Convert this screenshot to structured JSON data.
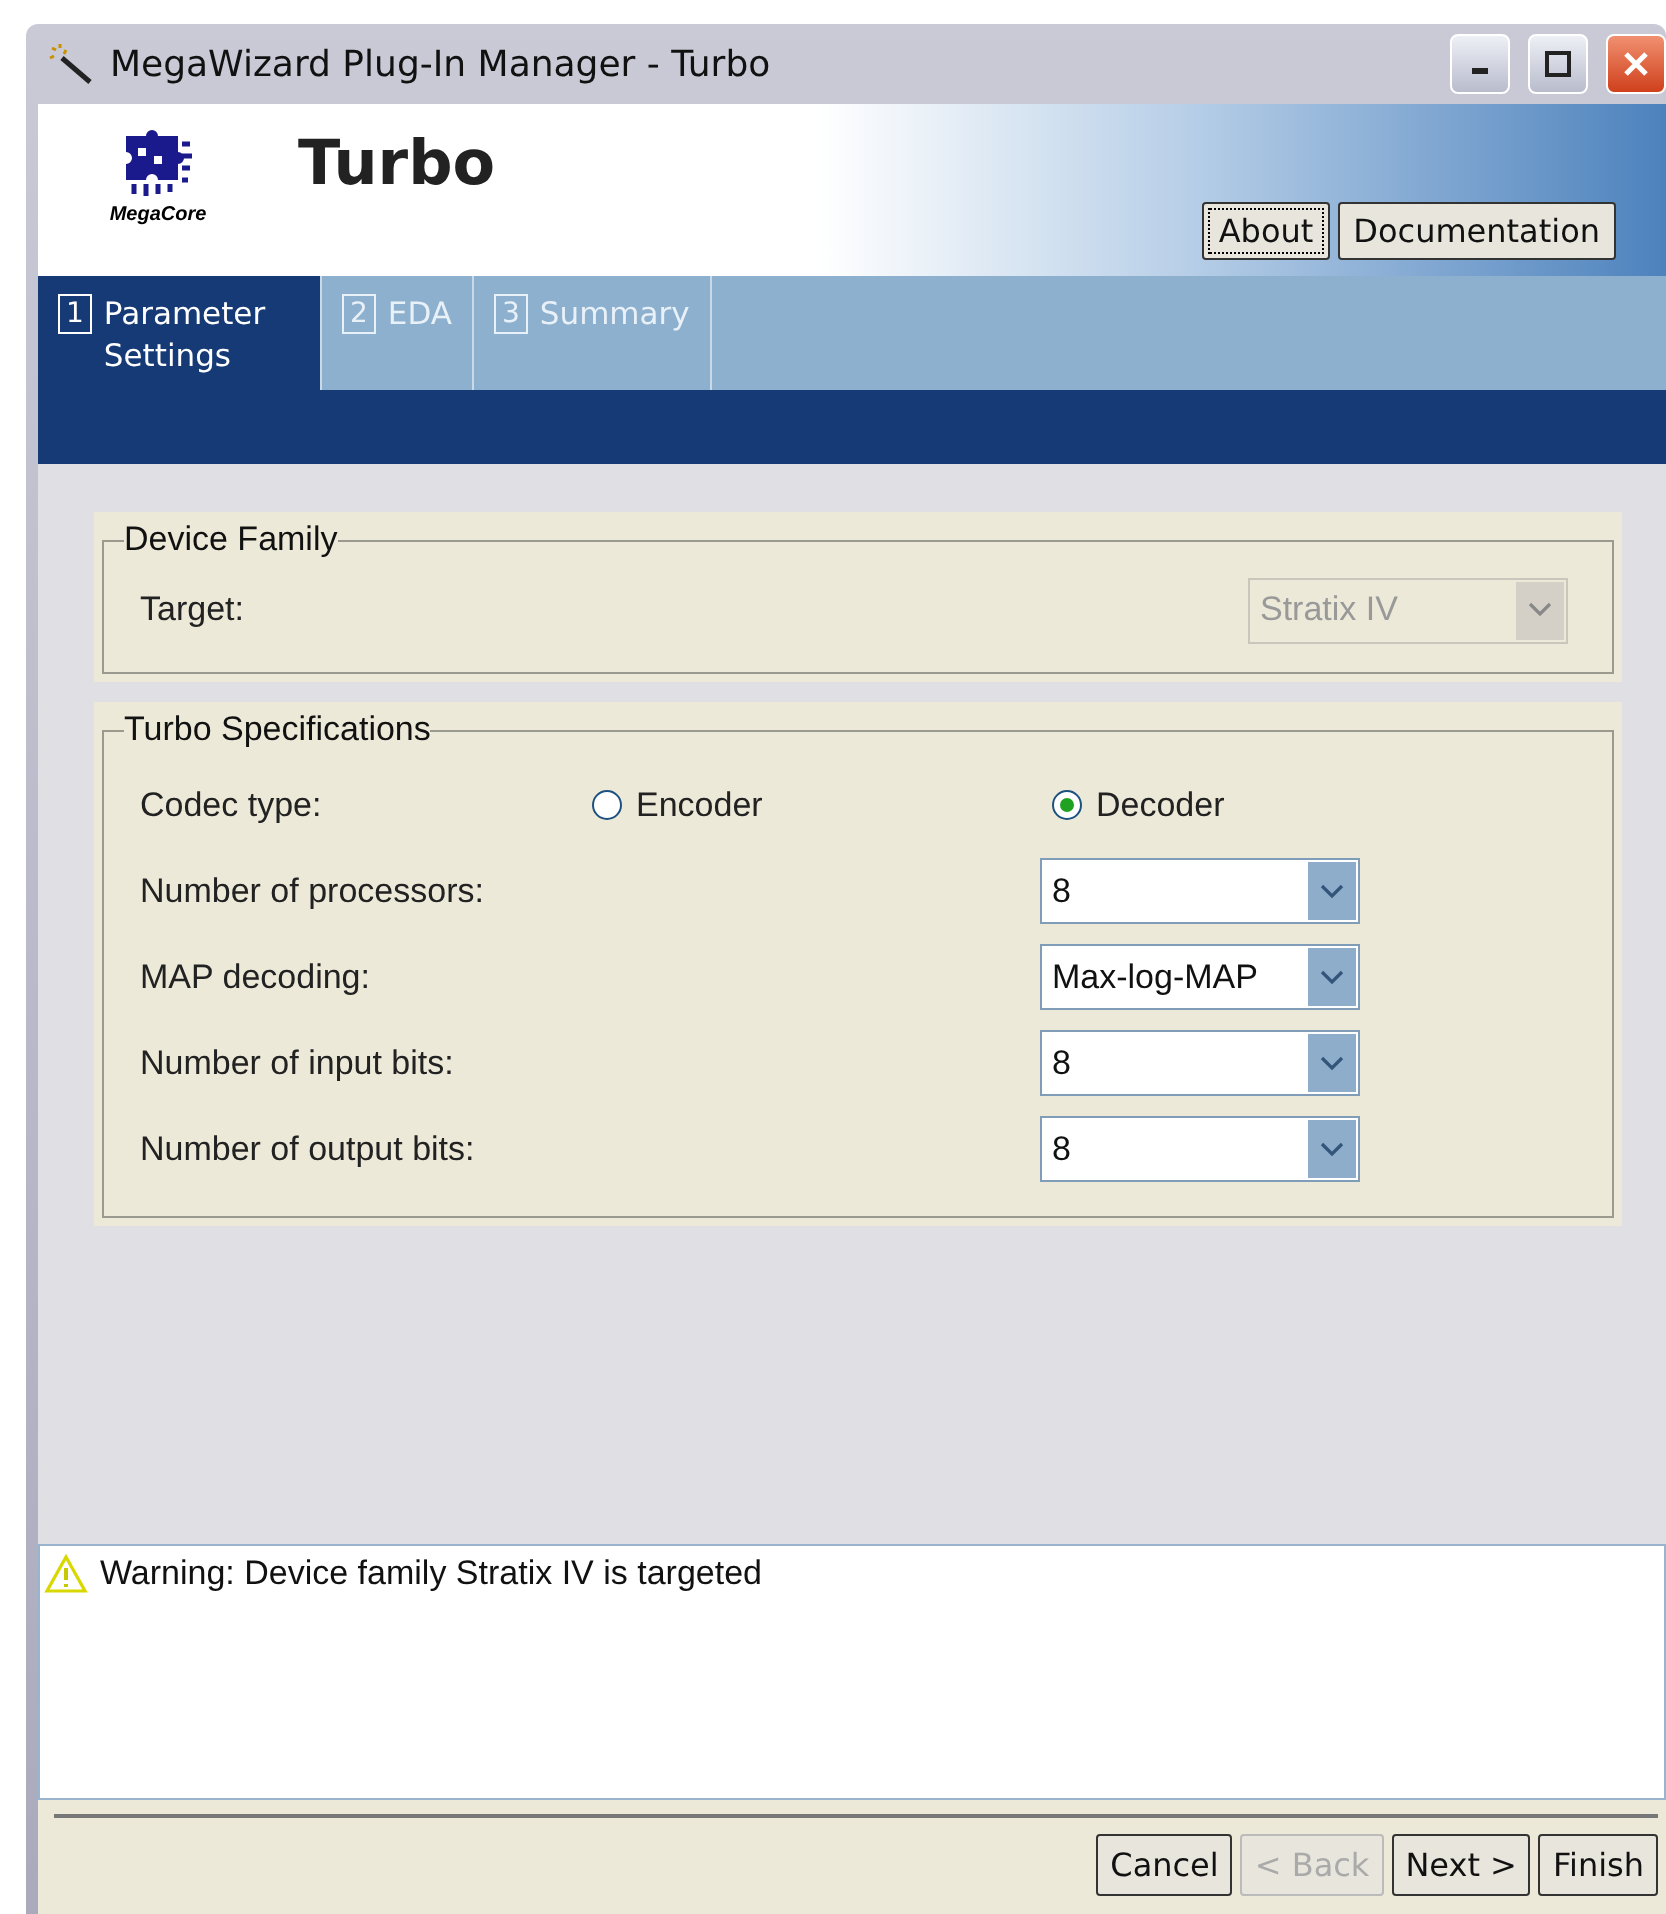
{
  "window": {
    "title": "MegaWizard Plug-In Manager - Turbo"
  },
  "header": {
    "title": "Turbo",
    "logo_caption": "MegaCore",
    "buttons": [
      {
        "label": "About",
        "focused": true
      },
      {
        "label": "Documentation",
        "focused": false
      }
    ]
  },
  "tabs": [
    {
      "number": "1",
      "label": "Parameter Settings",
      "selected": true
    },
    {
      "number": "2",
      "label": "EDA",
      "selected": false
    },
    {
      "number": "3",
      "label": "Summary",
      "selected": false
    }
  ],
  "device_family": {
    "title": "Device Family",
    "label": "Target:",
    "value": "Stratix IV",
    "disabled": true
  },
  "turbo_specifications": {
    "title": "Turbo Specifications",
    "codec_type": {
      "label": "Codec type:",
      "options": [
        {
          "label": "Encoder",
          "selected": false
        },
        {
          "label": "Decoder",
          "selected": true
        }
      ]
    },
    "fields": [
      {
        "label": "Number of processors:",
        "value": "8"
      },
      {
        "label": "MAP decoding:",
        "value": "Max-log-MAP"
      },
      {
        "label": "Number of input bits:",
        "value": "8"
      },
      {
        "label": "Number of output bits:",
        "value": "8"
      }
    ]
  },
  "messages": [
    {
      "kind": "warning",
      "text": "Warning: Device family Stratix IV is targeted"
    }
  ],
  "footer_buttons": [
    {
      "label": "Cancel",
      "disabled": false
    },
    {
      "label": "< Back",
      "disabled": true
    },
    {
      "label": "Next >",
      "disabled": false
    },
    {
      "label": "Finish",
      "disabled": false
    }
  ]
}
